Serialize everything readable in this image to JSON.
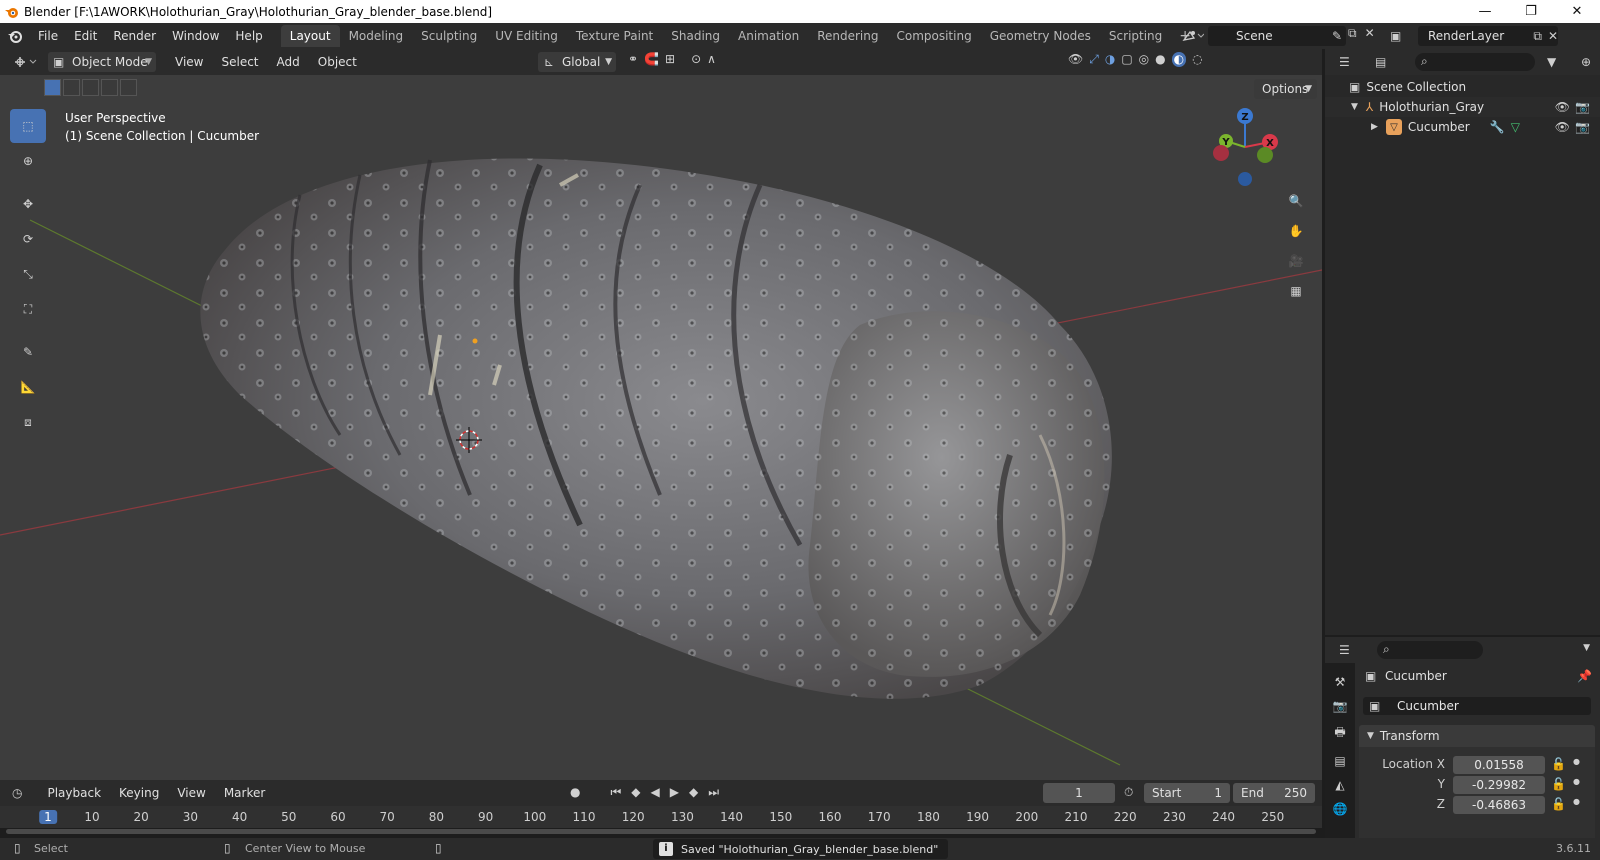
{
  "window": {
    "title": "Blender [F:\\1AWORK\\Holothurian_Gray\\Holothurian_Gray_blender_base.blend]",
    "controls": [
      "—",
      "❐",
      "✕"
    ]
  },
  "menu": {
    "items": [
      "File",
      "Edit",
      "Render",
      "Window",
      "Help"
    ]
  },
  "workspaces": {
    "tabs": [
      "Layout",
      "Modeling",
      "Sculpting",
      "UV Editing",
      "Texture Paint",
      "Shading",
      "Animation",
      "Rendering",
      "Compositing",
      "Geometry Nodes",
      "Scripting"
    ],
    "active": "Layout",
    "add_label": "+"
  },
  "scene": {
    "name": "Scene"
  },
  "view_layer": {
    "name": "RenderLayer"
  },
  "viewport": {
    "mode": "Object Mode",
    "menus": [
      "View",
      "Select",
      "Add",
      "Object"
    ],
    "transform_orientation": "Global",
    "options_label": "Options",
    "info_line1": "User Perspective",
    "info_line2": "(1) Scene Collection | Cucumber",
    "gizmo": {
      "x": "X",
      "y": "Y",
      "z": "Z"
    }
  },
  "outliner": {
    "root": "Scene Collection",
    "items": [
      {
        "name": "Holothurian_Gray",
        "indent": 1
      },
      {
        "name": "Cucumber",
        "indent": 2
      }
    ]
  },
  "properties": {
    "object_name": "Cucumber",
    "object_field": "Cucumber",
    "section": "Transform",
    "location": {
      "x_label": "Location X",
      "y_label": "Y",
      "z_label": "Z",
      "x": "0.01558",
      "y": "-0.29982",
      "z": "-0.46863"
    }
  },
  "timeline": {
    "menus": [
      "Playback",
      "Keying",
      "View",
      "Marker"
    ],
    "current_frame": "1",
    "start_label": "Start",
    "start": "1",
    "end_label": "End",
    "end": "250",
    "ruler": [
      "1",
      "10",
      "20",
      "30",
      "40",
      "50",
      "60",
      "70",
      "80",
      "90",
      "100",
      "110",
      "120",
      "130",
      "140",
      "150",
      "160",
      "170",
      "180",
      "190",
      "200",
      "210",
      "220",
      "230",
      "240",
      "250"
    ]
  },
  "statusbar": {
    "select": "Select",
    "center_view": "Center View to Mouse",
    "message": "Saved \"Holothurian_Gray_blender_base.blend\"",
    "version": "3.6.11"
  },
  "colors": {
    "accent": "#4772b3",
    "x_axis": "#d9394a",
    "y_axis": "#7bb52d",
    "z_axis": "#3b79d1"
  }
}
